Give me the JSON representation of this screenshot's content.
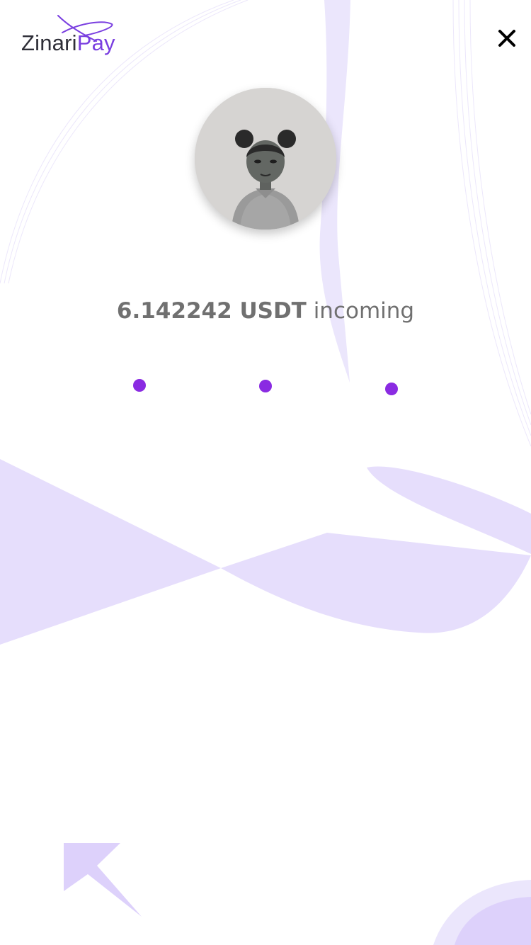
{
  "brand": {
    "name_part1": "Zinari",
    "name_part2": "Pay",
    "accent_color": "#7a3fe0"
  },
  "header": {
    "close_icon": "close-icon"
  },
  "transfer": {
    "amount": "6.142242 USDT",
    "status_word": "incoming"
  },
  "loader": {
    "dot_color": "#8a2be2",
    "dot_count": 3
  },
  "colors": {
    "background": "#ffffff",
    "shape_fill": "#e6defc",
    "text": "#707070"
  }
}
